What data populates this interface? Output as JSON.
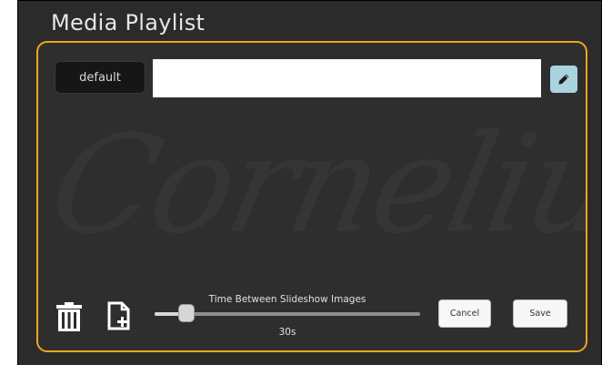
{
  "window": {
    "title": "Media Playlist"
  },
  "playlist": {
    "name_button_label": "default",
    "name_input_value": "",
    "name_input_placeholder": "",
    "edit_icon": "pencil-icon"
  },
  "watermark": {
    "text": "Cornelius"
  },
  "toolbar": {
    "delete_icon": "trash-icon",
    "add_icon": "add-file-icon"
  },
  "slideshow": {
    "label": "Time Between Slideshow Images",
    "value_text": "30s",
    "position_fraction": 0.12
  },
  "actions": {
    "cancel_label": "Cancel",
    "save_label": "Save"
  },
  "colors": {
    "accent": "#f0a51e",
    "background": "#2b2b2b",
    "edit_button": "#a9d3df"
  }
}
